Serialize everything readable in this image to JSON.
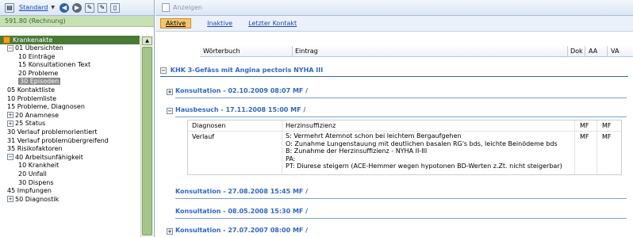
{
  "left_toolbar": {
    "standard_label": "Standard"
  },
  "amount": "591.80 (Rechnung)",
  "tree": {
    "root": "Krankenakte",
    "items": [
      {
        "label": "01 Übersichten",
        "indent": 1,
        "toggle": "−"
      },
      {
        "label": "10 Einträge",
        "indent": 3,
        "toggle": ""
      },
      {
        "label": "15 Konsultationen Text",
        "indent": 3,
        "toggle": ""
      },
      {
        "label": "20 Probleme",
        "indent": 3,
        "toggle": ""
      },
      {
        "label": "30 Episoden",
        "indent": 3,
        "toggle": "",
        "selected": true
      },
      {
        "label": "05 Kontaktliste",
        "indent": 1,
        "toggle": ""
      },
      {
        "label": "10 Problemliste",
        "indent": 1,
        "toggle": ""
      },
      {
        "label": "15 Probleme, Diagnosen",
        "indent": 1,
        "toggle": ""
      },
      {
        "label": "20 Anamnese",
        "indent": 1,
        "toggle": "+"
      },
      {
        "label": "25 Status",
        "indent": 1,
        "toggle": "+"
      },
      {
        "label": "30 Verlauf problemorientiert",
        "indent": 1,
        "toggle": ""
      },
      {
        "label": "31 Verlauf problemübergreifend",
        "indent": 1,
        "toggle": ""
      },
      {
        "label": "35 Risikofaktoren",
        "indent": 1,
        "toggle": ""
      },
      {
        "label": "40 Arbeitsunfähigkeit",
        "indent": 1,
        "toggle": "−"
      },
      {
        "label": "10 Krankheit",
        "indent": 3,
        "toggle": ""
      },
      {
        "label": "20 Unfall",
        "indent": 3,
        "toggle": ""
      },
      {
        "label": "30 Dispens",
        "indent": 3,
        "toggle": ""
      },
      {
        "label": "45 Impfungen",
        "indent": 1,
        "toggle": ""
      },
      {
        "label": "50 Diagnostik",
        "indent": 1,
        "toggle": "+"
      }
    ]
  },
  "right_toolbar": {
    "anzeigen": "Anzeigen"
  },
  "tabs": {
    "aktive": "Aktive",
    "inaktive": "Inaktive",
    "letzter": "Letzter Kontakt"
  },
  "columns": {
    "woerterbuch": "Wörterbuch",
    "eintrag": "Eintrag",
    "dok": "Dok",
    "aa": "AA",
    "va": "VA"
  },
  "episode_title": "KHK 3-Gefäss mit Angina pectoris NYHA III",
  "entries": [
    {
      "label": "Konsultation - 02.10.2009 08:07 MF /",
      "toggle": "+"
    },
    {
      "label": "Hausbesuch - 17.11.2008 15:00 MF /",
      "toggle": "−"
    },
    {
      "label": "Konsultation - 27.08.2008 15:45 MF /",
      "toggle": ""
    },
    {
      "label": "Konsultation - 08.05.2008 15:30 MF /",
      "toggle": ""
    },
    {
      "label": "Konsultation - 27.07.2007 08:00 MF /",
      "toggle": "+"
    }
  ],
  "detail": {
    "row1": {
      "label": "Diagnosen",
      "text": "Herzinsuffizienz",
      "aa": "MF",
      "va": "MF"
    },
    "row2": {
      "label": "Verlauf",
      "lines": [
        "S: Vermehrt Atemnot schon bei leichtem Bergaufgehen",
        "O: Zunahme Lungenstauung mit deutlichen basalen RG's bds, leichte Beinödeme bds",
        "B: Zunahme der Herzinsuffizienz - NYHA II-III",
        "PA:",
        "PT: Diurese steigern (ACE-Hemmer wegen hypotonen BD-Werten z.Zt. nicht steigerbar)"
      ],
      "aa": "MF",
      "va": "MF"
    }
  }
}
